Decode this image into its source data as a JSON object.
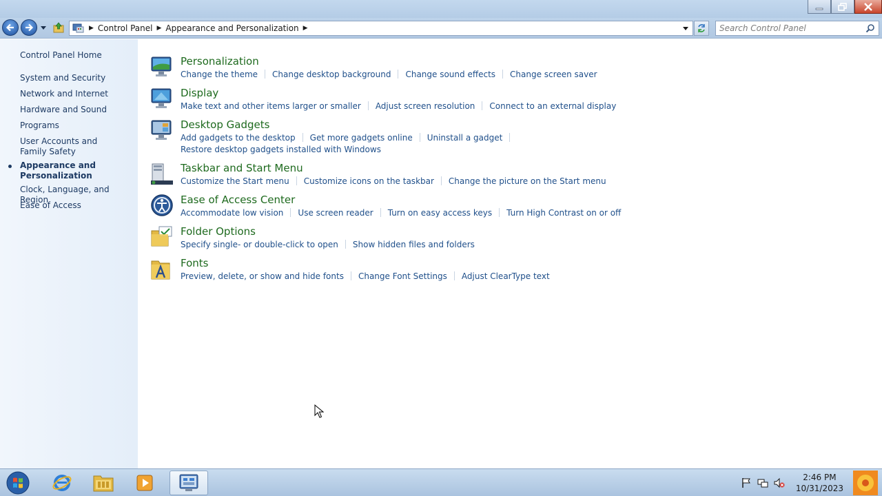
{
  "window": {
    "minimize_label": "Minimize",
    "restore_label": "Restore",
    "close_label": "Close"
  },
  "address": {
    "breadcrumbs": [
      "Control Panel",
      "Appearance and Personalization"
    ],
    "search_placeholder": "Search Control Panel"
  },
  "sidebar": {
    "home": "Control Panel Home",
    "items": [
      {
        "label": "System and Security"
      },
      {
        "label": "Network and Internet"
      },
      {
        "label": "Hardware and Sound"
      },
      {
        "label": "Programs"
      },
      {
        "label": "User Accounts and Family Safety"
      },
      {
        "label": "Appearance and Personalization",
        "active": true
      },
      {
        "label": "Clock, Language, and Region"
      },
      {
        "label": "Ease of Access"
      }
    ]
  },
  "categories": [
    {
      "title": "Personalization",
      "icon": "personalization-icon",
      "links": [
        "Change the theme",
        "Change desktop background",
        "Change sound effects",
        "Change screen saver"
      ]
    },
    {
      "title": "Display",
      "icon": "display-icon",
      "links": [
        "Make text and other items larger or smaller",
        "Adjust screen resolution",
        "Connect to an external display"
      ]
    },
    {
      "title": "Desktop Gadgets",
      "icon": "gadgets-icon",
      "links": [
        "Add gadgets to the desktop",
        "Get more gadgets online",
        "Uninstall a gadget",
        "Restore desktop gadgets installed with Windows"
      ]
    },
    {
      "title": "Taskbar and Start Menu",
      "icon": "taskbar-icon",
      "links": [
        "Customize the Start menu",
        "Customize icons on the taskbar",
        "Change the picture on the Start menu"
      ]
    },
    {
      "title": "Ease of Access Center",
      "icon": "ease-of-access-icon",
      "links": [
        "Accommodate low vision",
        "Use screen reader",
        "Turn on easy access keys",
        "Turn High Contrast on or off"
      ]
    },
    {
      "title": "Folder Options",
      "icon": "folder-options-icon",
      "links": [
        "Specify single- or double-click to open",
        "Show hidden files and folders"
      ]
    },
    {
      "title": "Fonts",
      "icon": "fonts-icon",
      "links": [
        "Preview, delete, or show and hide fonts",
        "Change Font Settings",
        "Adjust ClearType text"
      ]
    }
  ],
  "taskbar": {
    "apps": [
      "internet-explorer-icon",
      "windows-explorer-icon",
      "media-player-icon",
      "control-panel-icon"
    ],
    "clock_time": "2:46 PM",
    "clock_date": "10/31/2023"
  },
  "colors": {
    "link": "#1f4f8a",
    "category_title": "#1e6a1e",
    "sidebar_text": "#1d3a63"
  }
}
